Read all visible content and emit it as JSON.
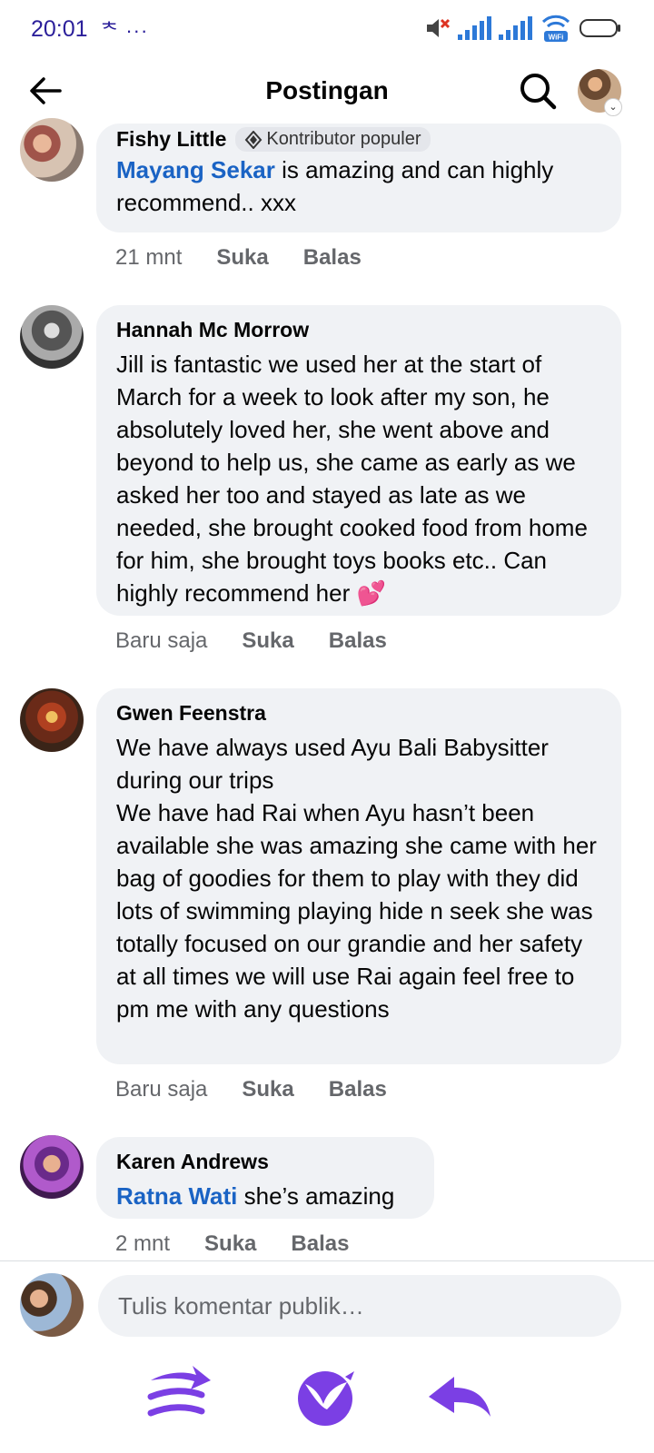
{
  "status_bar": {
    "time": "20:01",
    "extra": "ᅕ ···",
    "wifi_label": "WiFi"
  },
  "header": {
    "title": "Postingan"
  },
  "comments": [
    {
      "author": "Fishy Little",
      "badge": "Kontributor populer",
      "mention": "Mayang Sekar",
      "text": " is amazing and can highly recommend.. xxx",
      "time": "21 mnt",
      "like": "Suka",
      "reply": "Balas"
    },
    {
      "author": "Hannah Mc Morrow",
      "text": "Jill is fantastic we used her at the start of March for a week to look after my son, he absolutely loved her, she went above and beyond to help us, she came as early as we asked her too and stayed as late as we needed, she brought cooked food from home for him, she brought toys books etc.. Can highly recommend her 💕",
      "time": "Baru saja",
      "like": "Suka",
      "reply": "Balas"
    },
    {
      "author": "Gwen Feenstra",
      "text": "We have always used Ayu Bali Babysitter during our trips\nWe have had Rai when Ayu hasn’t been available she was amazing she came with her bag of goodies for them to play with they did lots of swimming playing hide n seek she was totally focused on our grandie and her safety at all times we will use Rai again feel free to pm me with any questions",
      "time": "Baru saja",
      "like": "Suka",
      "reply": "Balas"
    },
    {
      "author": "Karen Andrews",
      "mention": "Ratna Wati",
      "text": " she’s amazing",
      "time": "2 mnt",
      "like": "Suka",
      "reply": "Balas"
    }
  ],
  "composer": {
    "placeholder": "Tulis komentar publik…"
  },
  "icons": {
    "back": "arrow-left-icon",
    "search": "search-icon",
    "nav_left": "multi-arrow-icon",
    "nav_center": "bird-logo-icon",
    "nav_right": "reply-arrow-icon"
  },
  "colors": {
    "mention": "#1a63c4",
    "nav_accent": "#7b3fe4",
    "status_text": "#2b1f9a"
  }
}
